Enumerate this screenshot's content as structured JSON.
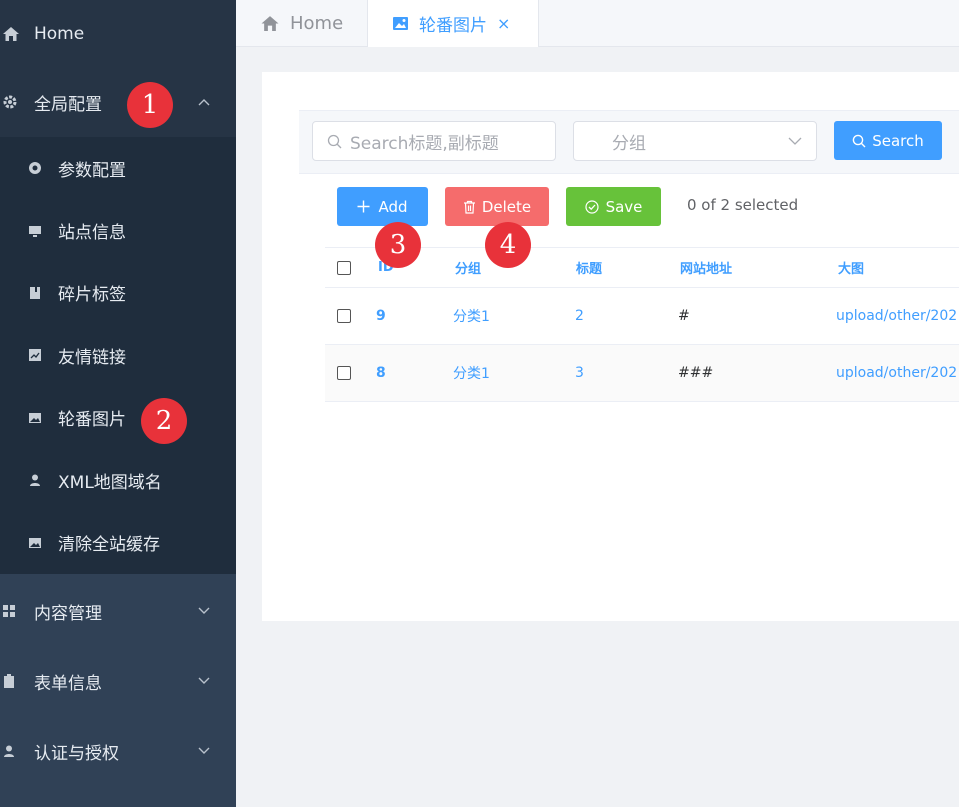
{
  "sidebar": {
    "home": "Home",
    "global_config": "全局配置",
    "sub_items": [
      "参数配置",
      "站点信息",
      "碎片标签",
      "友情链接",
      "轮番图片",
      "XML地图域名",
      "清除全站缓存"
    ],
    "content_mgmt": "内容管理",
    "form_info": "表单信息",
    "auth": "认证与授权"
  },
  "badges": [
    "1",
    "2",
    "3",
    "4"
  ],
  "tabs": {
    "home": "Home",
    "active": "轮番图片",
    "close": "×"
  },
  "search": {
    "keyword_placeholder": "Search标题,副标题",
    "group_placeholder": "分组",
    "search_label": "Search"
  },
  "toolbar": {
    "add": "Add",
    "delete": "Delete",
    "save": "Save",
    "selected_text": "0 of 2 selected"
  },
  "table": {
    "headers": [
      "ID",
      "分组",
      "标题",
      "网站地址",
      "大图"
    ],
    "rows": [
      {
        "id": "9",
        "group": "分类1",
        "title": "2",
        "url": "#",
        "image": "upload/other/202"
      },
      {
        "id": "8",
        "group": "分类1",
        "title": "3",
        "url": "###",
        "image": "upload/other/202"
      }
    ]
  },
  "colors": {
    "sidebar_bg": "#304156",
    "primary": "#409eff",
    "danger": "#f56c6c",
    "success": "#67c23a",
    "badge": "#e8323a"
  },
  "icons": [
    "home-icon",
    "gear-icon",
    "image-icon",
    "close-icon",
    "search-icon",
    "plus-icon",
    "trash-icon",
    "check-circle-icon",
    "chevron-down-icon"
  ]
}
